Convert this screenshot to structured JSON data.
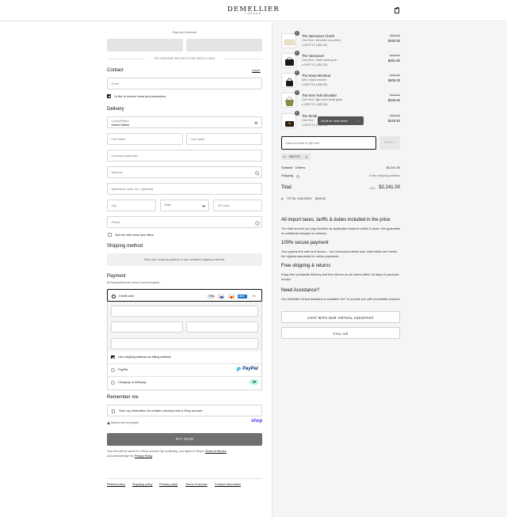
{
  "header": {
    "logo": "DEMELLIER",
    "logo_sub": "LONDON",
    "cart_icon": "shopping-bag-icon"
  },
  "express": {
    "title": "Express checkout",
    "divider_text": "OR CONTINUE BELOW TO PAY WITH A CARD"
  },
  "contact": {
    "heading": "Contact",
    "login": "Log in",
    "email_placeholder": "Email",
    "news_label": "I'd like to receive news and promotions",
    "news_checked": true
  },
  "delivery": {
    "heading": "Delivery",
    "country_label": "Country/Region",
    "country_value": "United States",
    "first_name": "First name",
    "last_name": "Last name",
    "company": "Company (optional)",
    "address": "Address",
    "apartment": "Apartment, suite, etc. (optional)",
    "city": "City",
    "state": "State",
    "zip": "ZIP code",
    "phone": "Phone",
    "text_me": "Text me with news and offers"
  },
  "shipping_method": {
    "heading": "Shipping method",
    "notice": "Enter your shipping address to view available shipping methods."
  },
  "payment": {
    "heading": "Payment",
    "subtitle": "All transactions are secure and encrypted.",
    "credit_card": "Credit card",
    "more_cards": "+4",
    "billing_same": "Use shipping address as billing address",
    "paypal": "PayPal",
    "paypal_logo": "PayPal",
    "clearpay": "Clearpay or Afterpay"
  },
  "remember": {
    "heading": "Remember me",
    "label": "Save my information for a faster checkout with a Shop account",
    "secure": "Secure and encrypted",
    "shop_logo": "shop"
  },
  "pay_now": "PAY NOW",
  "legal": {
    "line1": "Your info will be saved to a Shop account. By continuing, you agree to Shop's",
    "terms": "Terms of Service",
    "line2": "and acknowledge the",
    "privacy": "Privacy Policy",
    "end": "."
  },
  "footer": {
    "refund": "Refund policy",
    "shipping": "Shipping policy",
    "privacy": "Privacy policy",
    "terms": "Terms of service",
    "contact": "Contact information"
  },
  "cart": {
    "items": [
      {
        "qty": "1",
        "name": "The Vancouver Clutch",
        "meta": "One Size / off-white croc-effect",
        "code": "NEXT10 (-$54.50)",
        "old": "$545.00",
        "price": "$490.50"
      },
      {
        "qty": "1",
        "name": "The Vancouver",
        "meta": "One Size / black small grain",
        "code": "NEXT10 (-$53.50)",
        "old": "$535.00",
        "price": "$481.50"
      },
      {
        "qty": "1",
        "name": "The Nano Montreal",
        "meta": "Mini / black smooth",
        "code": "NEXT10 (-$45.00)",
        "old": "$450.00",
        "price": "$405.00"
      },
      {
        "qty": "1",
        "name": "The New York Shoulder",
        "meta": "One Size / light olive small grain",
        "code": "NEXT10 (-$49.50)",
        "old": "$495.00",
        "price": "$445.50"
      },
      {
        "qty": "1",
        "name": "The Small",
        "meta": "One Size",
        "code": "NEXT10 (-$46.50)",
        "old": "$465.00",
        "price": "$418.50"
      }
    ],
    "scroll_hint": "Scroll for more items",
    "discount_placeholder": "Discount code or gift card",
    "apply": "APPLY",
    "code_tag": "NEXT10",
    "subtotal_label": "Subtotal · 5 items",
    "subtotal_value": "$2,241.00",
    "shipping_label": "Shipping",
    "shipping_value": "Enter shipping address",
    "total_label": "Total",
    "currency": "USD",
    "total_value": "$2,241.00",
    "savings_label": "TOTAL SAVINGS",
    "savings_value": "$249.00"
  },
  "info": {
    "taxes_h": "All import taxes, tariffs & duties included in the price",
    "taxes_p": "The total amount you pay includes all applicable customs duties & taxes. We guarantee no additional charges on delivery.",
    "secure_h": "100% secure payment",
    "secure_p": "Your payment is safe and secure – our checkout protects your information and meets the highest standards for online payments.",
    "free_h": "Free shipping & returns",
    "free_p": "Enjoy free worldwide delivery and free returns on all orders within 28 days of purchase receipt",
    "assist_h": "Need Assistance?",
    "assist_p": "Our DeMellier Virtual Assistant is available 24/7 to provide you with immediate answers.",
    "chat_btn": "CHAT WITH OUR VIRTUAL ASSISTANT",
    "call_btn": "CALL US"
  }
}
